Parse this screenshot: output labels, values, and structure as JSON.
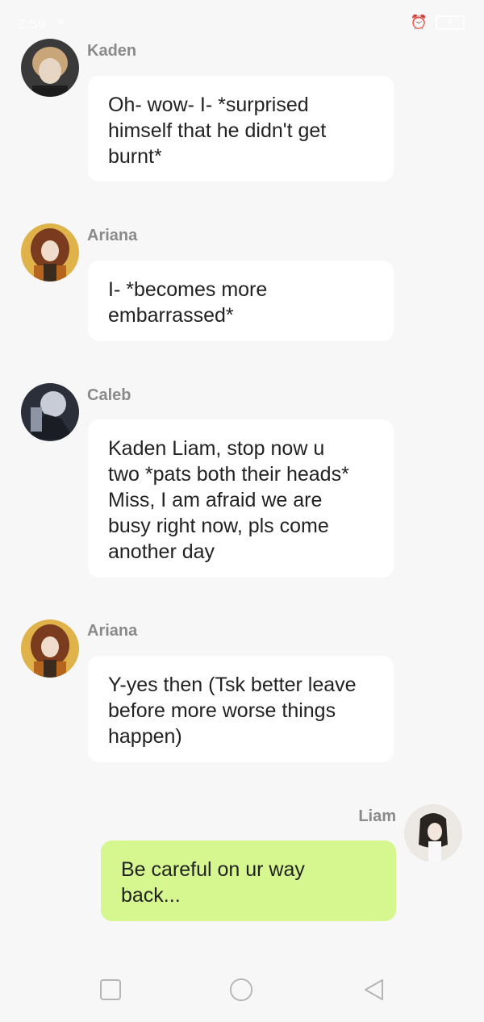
{
  "status_bar": {
    "time": "2:59",
    "signal": ".ıll",
    "battery": "8"
  },
  "messages": [
    {
      "sender": "Kaden",
      "text": "Oh- wow- I- *surprised\nhimself that he didn't get\nburnt*",
      "mine": false
    },
    {
      "sender": "Ariana",
      "text": "I- *becomes more\nembarrassed*",
      "mine": false
    },
    {
      "sender": "Caleb",
      "text": "Kaden Liam, stop now u\ntwo *pats both their heads*\nMiss, I am afraid we are\nbusy right now, pls come\nanother day",
      "mine": false
    },
    {
      "sender": "Ariana",
      "text": "Y-yes then (Tsk better leave\nbefore more worse things\nhappen)",
      "mine": false
    },
    {
      "sender": "Liam",
      "text": "Be careful on ur way\nback...",
      "mine": true
    }
  ],
  "colors": {
    "background": "#f7f7f7",
    "bubble_other": "#ffffff",
    "bubble_mine": "#d6f68f",
    "sender_name": "#8a8a8a"
  }
}
